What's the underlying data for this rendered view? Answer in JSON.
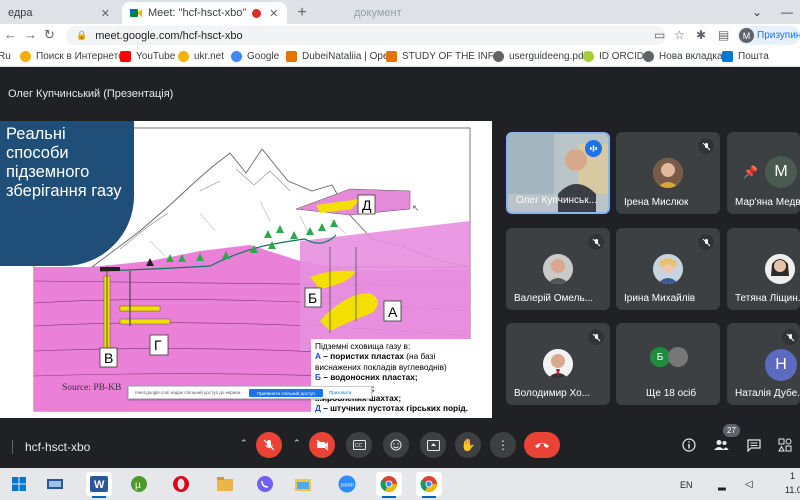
{
  "browser": {
    "tabs": [
      {
        "label": "едра"
      },
      {
        "label": "Meet: \"hcf-hsct-xbo\"",
        "recording": true
      },
      {
        "label": "документ"
      }
    ],
    "url": "meet.google.com/hcf-hsct-xbo",
    "profile": {
      "initial": "M",
      "label": "Призупинено"
    },
    "bookmarks": [
      {
        "label": "Ru",
        "icon": "bookmark-icon"
      },
      {
        "label": "Поиск в Интернете",
        "icon": "search-bookmark-icon"
      },
      {
        "label": "YouTube",
        "icon": "youtube-icon",
        "color": "#ff0000"
      },
      {
        "label": "ukr.net",
        "icon": "ukrnet-icon",
        "color": "#f4b400"
      },
      {
        "label": "Google",
        "icon": "google-icon",
        "color": "#4285f4"
      },
      {
        "label": "DubeiNataliia | Ope...",
        "icon": "bookmark-icon",
        "color": "#e37400"
      },
      {
        "label": "STUDY OF THE INF...",
        "icon": "doc-icon",
        "color": "#e37400"
      },
      {
        "label": "userguideeng.pdf",
        "icon": "globe-icon",
        "color": "#5f6368"
      },
      {
        "label": "ID ORCID",
        "icon": "orcid-icon",
        "color": "#a6ce39"
      },
      {
        "label": "Нова вкладка",
        "icon": "globe-icon",
        "color": "#5f6368"
      },
      {
        "label": "Пошта",
        "icon": "mail-icon",
        "color": "#0078d4"
      }
    ]
  },
  "meet": {
    "presenter_label": "Олег Купчинський (Презентація)",
    "meeting_code": "hcf-hsct-xbo",
    "people_count": "27",
    "slide": {
      "title": "Реальні способи підземного зберігання газу",
      "labels": {
        "a": "А",
        "b": "Б",
        "v": "В",
        "g": "Г",
        "d": "Д"
      },
      "source": "Source:  PB-KB",
      "legend": {
        "heading": "Підземні сховища газу в:",
        "line_a_key": "А",
        "line_a_text": " – пористих пластах",
        "line_a_note": " (на базі виснажених покладів вуглеводнів)",
        "line_b_key": "Б",
        "line_b_text": " – водоносних пластах;",
        "line_v_text": "...их кавернах;",
        "line_g_text": "...ироблених шахтах;",
        "line_d_key": "Д",
        "line_d_text": " – штучних пустотах гірських порід."
      },
      "sharebar": {
        "text": "meet.google.com надає спільний доступ до екрана.",
        "stop": "Припинити спільний доступ",
        "hide": "Приховати"
      }
    },
    "participants": [
      {
        "name": "Олег Купчинськ...",
        "speaking": true,
        "video": true
      },
      {
        "name": "Ірена Мислюк",
        "muted": true
      },
      {
        "name": "Мар'яна Медв...",
        "initial": "M",
        "pinned": true
      },
      {
        "name": "Валерій Омель...",
        "muted": true
      },
      {
        "name": "Ірина Михайлів",
        "muted": true
      },
      {
        "name": "Тетяна Ліщин...",
        "muted": true
      },
      {
        "name": "Володимир Хо...",
        "muted": true
      },
      {
        "name": "Ще 18 осіб",
        "initial": "Б"
      },
      {
        "name": "Наталія Дубе...",
        "initial": "Н",
        "muted": true
      }
    ],
    "colors": {
      "end_call": "#ea4335",
      "muted": "#ea4335",
      "accent": "#1a73e8"
    }
  },
  "taskbar": {
    "lang": "EN",
    "time": "1",
    "date": "11.0"
  }
}
